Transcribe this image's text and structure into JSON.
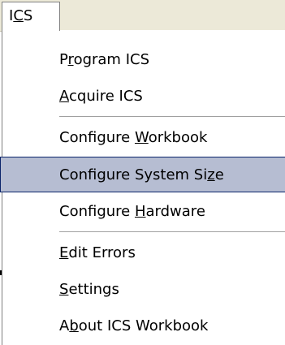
{
  "menubar": {
    "menu": {
      "label_pre": "I",
      "label_mnemonic": "C",
      "label_post": "S"
    }
  },
  "menu_items": [
    {
      "pre": "P",
      "mnemonic": "r",
      "post": "ogram ICS"
    },
    {
      "pre": "",
      "mnemonic": "A",
      "post": "cquire ICS"
    },
    {
      "pre": "Configure ",
      "mnemonic": "W",
      "post": "orkbook"
    },
    {
      "pre": "Configure System Si",
      "mnemonic": "z",
      "post": "e",
      "selected": true
    },
    {
      "pre": "Configure ",
      "mnemonic": "H",
      "post": "ardware"
    },
    {
      "pre": "",
      "mnemonic": "E",
      "post": "dit Errors"
    },
    {
      "pre": "",
      "mnemonic": "S",
      "post": "ettings"
    },
    {
      "pre": "A",
      "mnemonic": "b",
      "post": "out ICS Workbook"
    }
  ],
  "colors": {
    "highlight": "#b6bdd2",
    "highlight_border": "#0a246a",
    "menubar": "#ece9d8"
  }
}
